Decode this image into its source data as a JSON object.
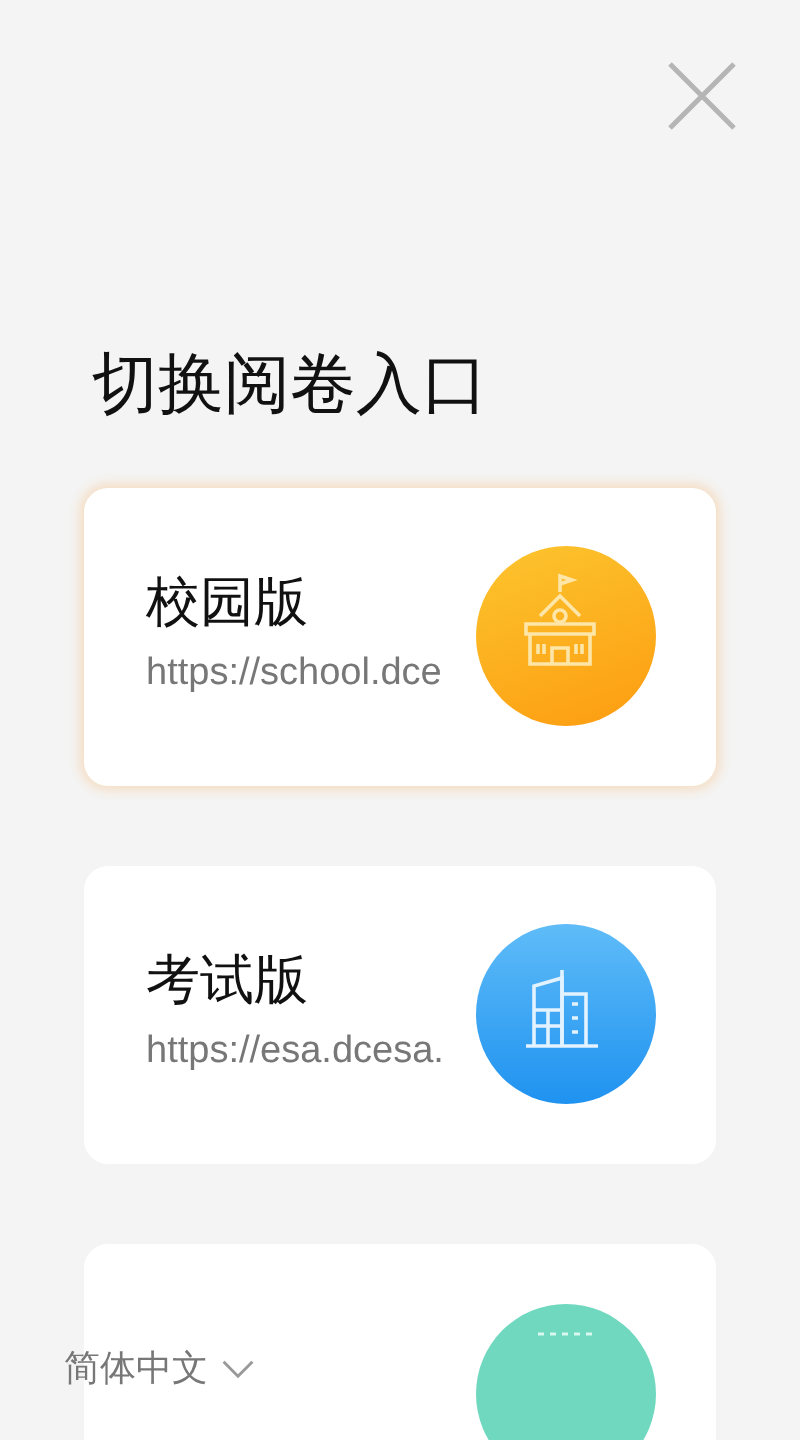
{
  "heading": "切换阅卷入口",
  "entries": [
    {
      "kind": "school",
      "title": "校园版",
      "url": "https://school.dce",
      "selected": true
    },
    {
      "kind": "building",
      "title": "考试版",
      "url": "https://esa.dcesa.",
      "selected": false
    },
    {
      "kind": "custom",
      "selected": false
    }
  ],
  "language": {
    "label": "简体中文"
  }
}
